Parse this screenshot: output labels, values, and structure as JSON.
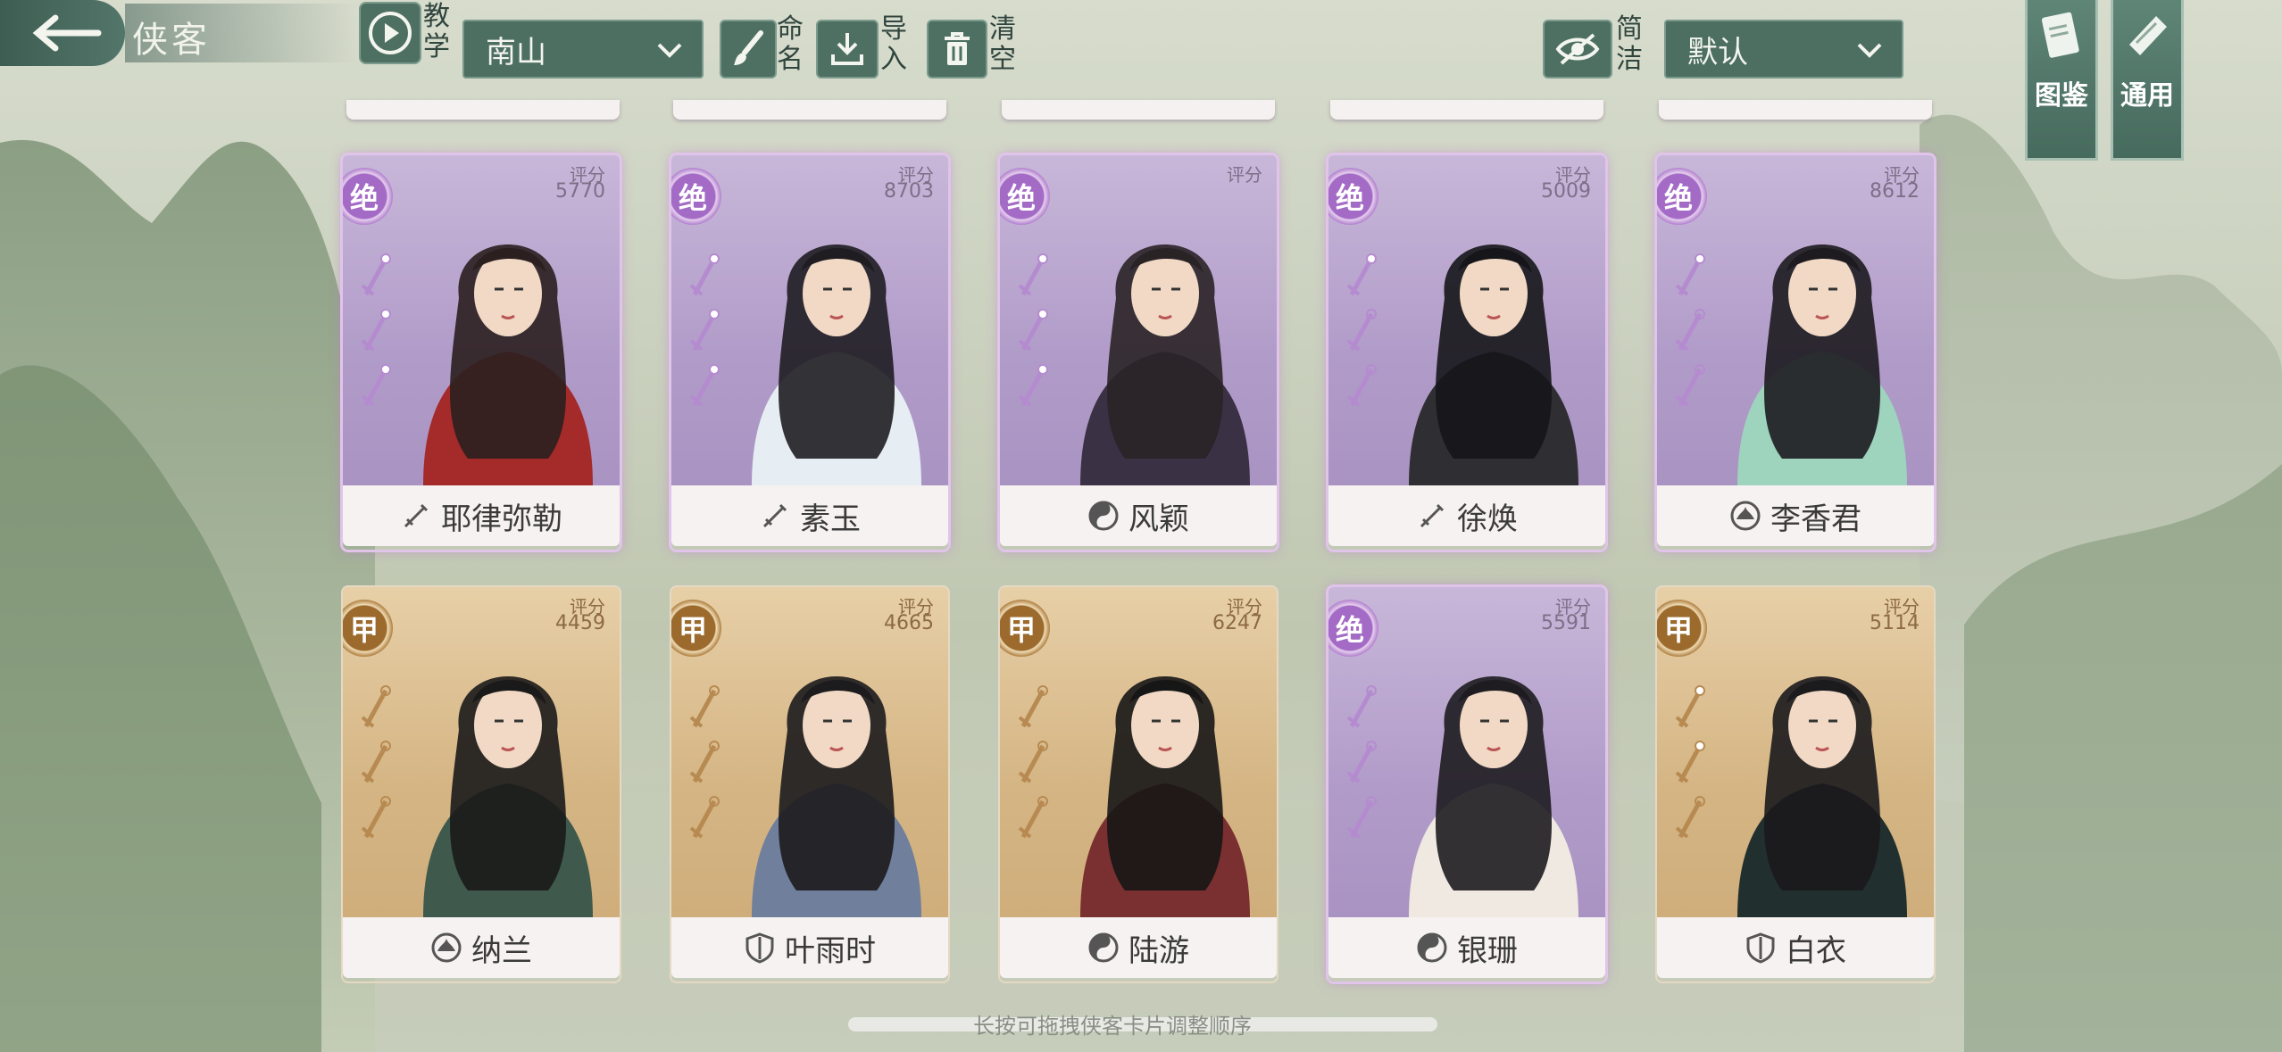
{
  "header": {
    "title": "侠客",
    "tutorial_label": "教学",
    "filter_value": "南山",
    "rename_label": "命名",
    "import_label": "导入",
    "clear_label": "清空",
    "simple_label": "简洁",
    "sort_value": "默认",
    "side_tabs": [
      "图鉴",
      "通用"
    ]
  },
  "score_label": "评分",
  "cards": [
    {
      "grade": "绝",
      "score": "5770",
      "name": "耶律弥勒",
      "type_icon": "sword-icon",
      "sword_count": 3,
      "cloth": "#a52a2a",
      "hair": "#2b1f1f"
    },
    {
      "grade": "绝",
      "score": "8703",
      "name": "素玉",
      "type_icon": "sword-icon",
      "sword_count": 3,
      "cloth": "#e6edf3",
      "hair": "#1f1d22"
    },
    {
      "grade": "绝",
      "score": "",
      "name": "风颖",
      "type_icon": "taiji-icon",
      "sword_count": 3,
      "cloth": "#3b3145",
      "hair": "#2a2326"
    },
    {
      "grade": "绝",
      "score": "5009",
      "name": "徐焕",
      "type_icon": "sword-icon",
      "sword_count": 1,
      "cloth": "#2f2f33",
      "hair": "#16161a"
    },
    {
      "grade": "绝",
      "score": "8612",
      "name": "李香君",
      "type_icon": "lotus-icon",
      "sword_count": 1,
      "cloth": "#9ed3bd",
      "hair": "#1d1b1f"
    },
    {
      "grade": "甲",
      "score": "4459",
      "name": "纳兰",
      "type_icon": "lotus-icon",
      "sword_count": 0,
      "cloth": "#3f5a4d",
      "hair": "#1b1a1a"
    },
    {
      "grade": "甲",
      "score": "4665",
      "name": "叶雨时",
      "type_icon": "shield-icon",
      "sword_count": 0,
      "cloth": "#6f7f9c",
      "hair": "#1c1b1d"
    },
    {
      "grade": "甲",
      "score": "6247",
      "name": "陆游",
      "type_icon": "taiji-icon",
      "sword_count": 0,
      "cloth": "#7a3030",
      "hair": "#171616"
    },
    {
      "grade": "绝",
      "score": "5591",
      "name": "银珊",
      "type_icon": "taiji-icon",
      "sword_count": 0,
      "cloth": "#efe9e2",
      "hair": "#1e1c20"
    },
    {
      "grade": "甲",
      "score": "5114",
      "name": "白衣",
      "type_icon": "shield-icon",
      "sword_count": 2,
      "cloth": "#21302e",
      "hair": "#1b1a1d"
    }
  ],
  "hint": "长按可拖拽侠客卡片调整顺序"
}
